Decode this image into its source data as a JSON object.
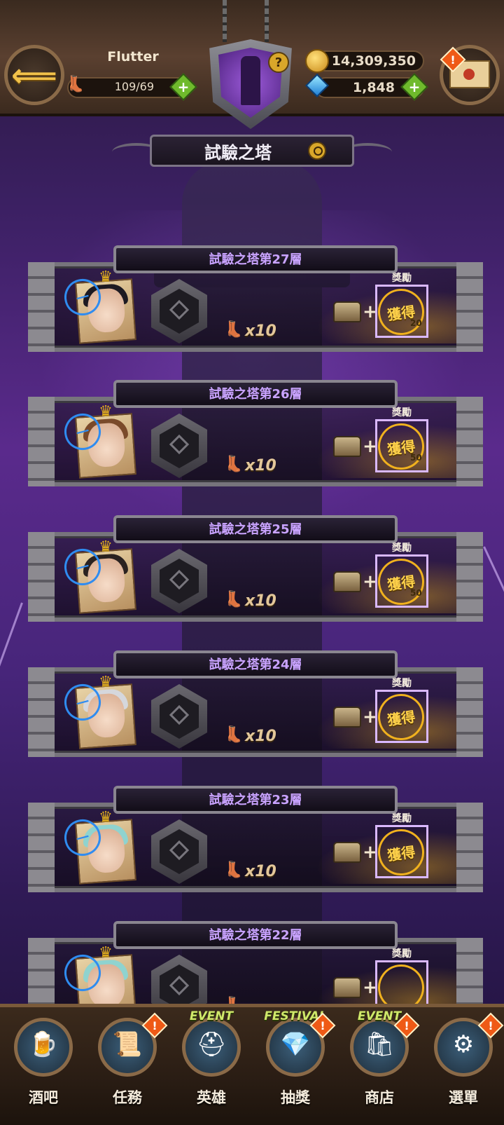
{
  "header": {
    "player_name": "Flutter",
    "stamina": "109/69",
    "gold": "14,309,350",
    "gems": "1,848",
    "help_symbol": "?",
    "plus_symbol": "+",
    "alert_symbol": "!"
  },
  "title": "試驗之塔",
  "floors": [
    {
      "title": "試驗之塔第27層",
      "cost": "x10",
      "reward_label": "獎勵",
      "reward_status": "獲得",
      "reward_count": "20",
      "stamp": "一",
      "hair": "#1d1a22"
    },
    {
      "title": "試驗之塔第26層",
      "cost": "x10",
      "reward_label": "獎勵",
      "reward_status": "獲得",
      "reward_count": "50",
      "stamp": "一",
      "hair": "#7a4a2a"
    },
    {
      "title": "試驗之塔第25層",
      "cost": "x10",
      "reward_label": "獎勵",
      "reward_status": "獲得",
      "reward_count": "50",
      "stamp": "一",
      "hair": "#2a2220"
    },
    {
      "title": "試驗之塔第24層",
      "cost": "x10",
      "reward_label": "獎勵",
      "reward_status": "獲得",
      "reward_count": "",
      "stamp": "一",
      "hair": "#d5d7dc"
    },
    {
      "title": "試驗之塔第23層",
      "cost": "x10",
      "reward_label": "獎勵",
      "reward_status": "獲得",
      "reward_count": "",
      "stamp": "一",
      "hair": "#8fd3cf"
    },
    {
      "title": "試驗之塔第22層",
      "cost": "",
      "reward_label": "獎勵",
      "reward_status": "",
      "reward_count": "",
      "stamp": "",
      "hair": "#8fd3cf"
    }
  ],
  "nav": [
    {
      "label": "酒吧",
      "icon": "tavern-icon",
      "event": "",
      "alert": false
    },
    {
      "label": "任務",
      "icon": "quest-scroll-icon",
      "event": "",
      "alert": true
    },
    {
      "label": "英雄",
      "icon": "hero-helmet-icon",
      "event": "EVENT",
      "alert": false
    },
    {
      "label": "抽獎",
      "icon": "gacha-crystal-icon",
      "event": "FESTIVAL",
      "alert": true
    },
    {
      "label": "商店",
      "icon": "shop-icon",
      "event": "EVENT",
      "alert": true
    },
    {
      "label": "選單",
      "icon": "menu-gear-icon",
      "event": "",
      "alert": true
    }
  ],
  "colors": {
    "floor_title": "#c9a3ff",
    "gold_accent": "#f0b11e",
    "plus_green": "#6fba2c",
    "alert_orange": "#ef5a16"
  }
}
